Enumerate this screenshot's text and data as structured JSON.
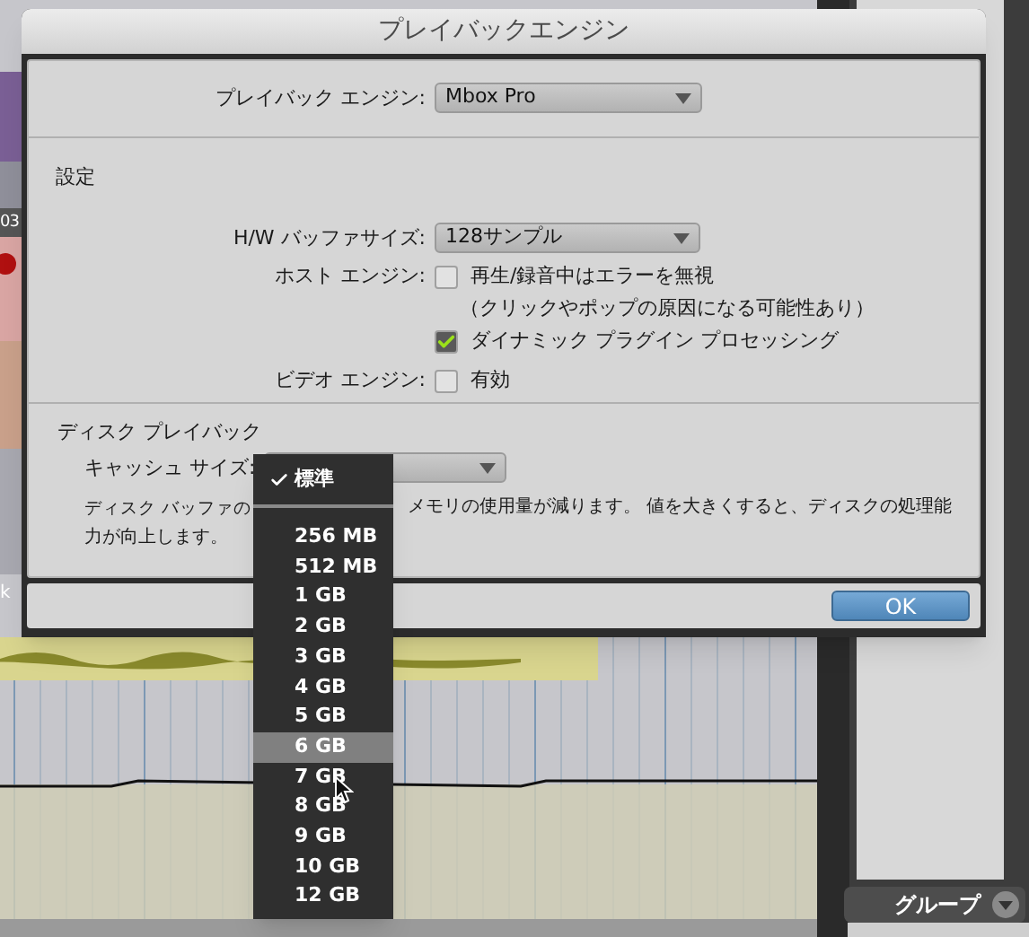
{
  "background": {
    "track_labels": [
      "03",
      "k"
    ],
    "group_button": "グループ"
  },
  "dialog": {
    "title": "プレイバックエンジン",
    "playback_engine": {
      "label": "プレイバック エンジン:",
      "value": "Mbox Pro"
    },
    "settings": {
      "heading": "設定",
      "buffer_size": {
        "label": "H/W バッファサイズ:",
        "value": "128サンプル"
      },
      "host_engine": {
        "label": "ホスト エンジン:",
        "options": [
          {
            "label": "再生/録音中はエラーを無視",
            "note": "（クリックやポップの原因になる可能性あり）",
            "checked": false
          },
          {
            "label": "ダイナミック プラグイン プロセッシング",
            "checked": true
          }
        ]
      },
      "video_engine": {
        "label": "ビデオ エンジン:",
        "option": {
          "label": "有効",
          "checked": false
        }
      }
    },
    "disk_playback": {
      "heading": "ディスク プレイバック",
      "cache_size": {
        "label": "キャッシュ サイズ:"
      },
      "description": [
        "ディスク バッファの",
        "メモリの使用量が減ります。 値を大きくすると、ディスクの処理能",
        "力が向上します。"
      ]
    },
    "ok_button": "OK"
  },
  "cache_menu": {
    "default_item": {
      "label": "標準",
      "checked": true
    },
    "size_items": [
      {
        "label": "256 MB",
        "selected": false
      },
      {
        "label": "512 MB",
        "selected": false
      },
      {
        "label": "1 GB",
        "selected": false
      },
      {
        "label": "2 GB",
        "selected": false
      },
      {
        "label": "3 GB",
        "selected": false
      },
      {
        "label": "4 GB",
        "selected": false
      },
      {
        "label": "5 GB",
        "selected": false
      },
      {
        "label": "6 GB",
        "selected": true
      },
      {
        "label": "7 GB",
        "selected": false
      },
      {
        "label": "8 GB",
        "selected": false
      },
      {
        "label": "9 GB",
        "selected": false
      },
      {
        "label": "10 GB",
        "selected": false
      },
      {
        "label": "12 GB",
        "selected": false
      }
    ]
  }
}
